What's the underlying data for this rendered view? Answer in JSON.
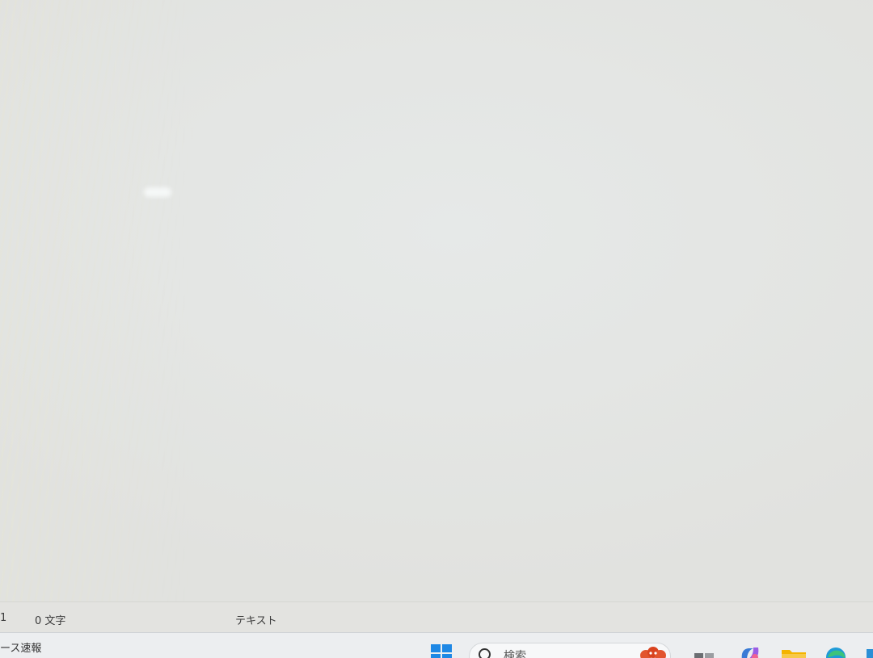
{
  "statusbar": {
    "line_number": "1",
    "char_count": "0 文字",
    "file_type": "テキスト"
  },
  "taskbar": {
    "news_widget_label": "ース速報",
    "search_placeholder": "検索",
    "start_icon": "windows-logo-icon",
    "pinned_icons": [
      "game-app-icon",
      "task-view-icon",
      "copilot-icon",
      "file-explorer-icon",
      "edge-browser-icon"
    ],
    "accent_color": "#1e88e5"
  }
}
